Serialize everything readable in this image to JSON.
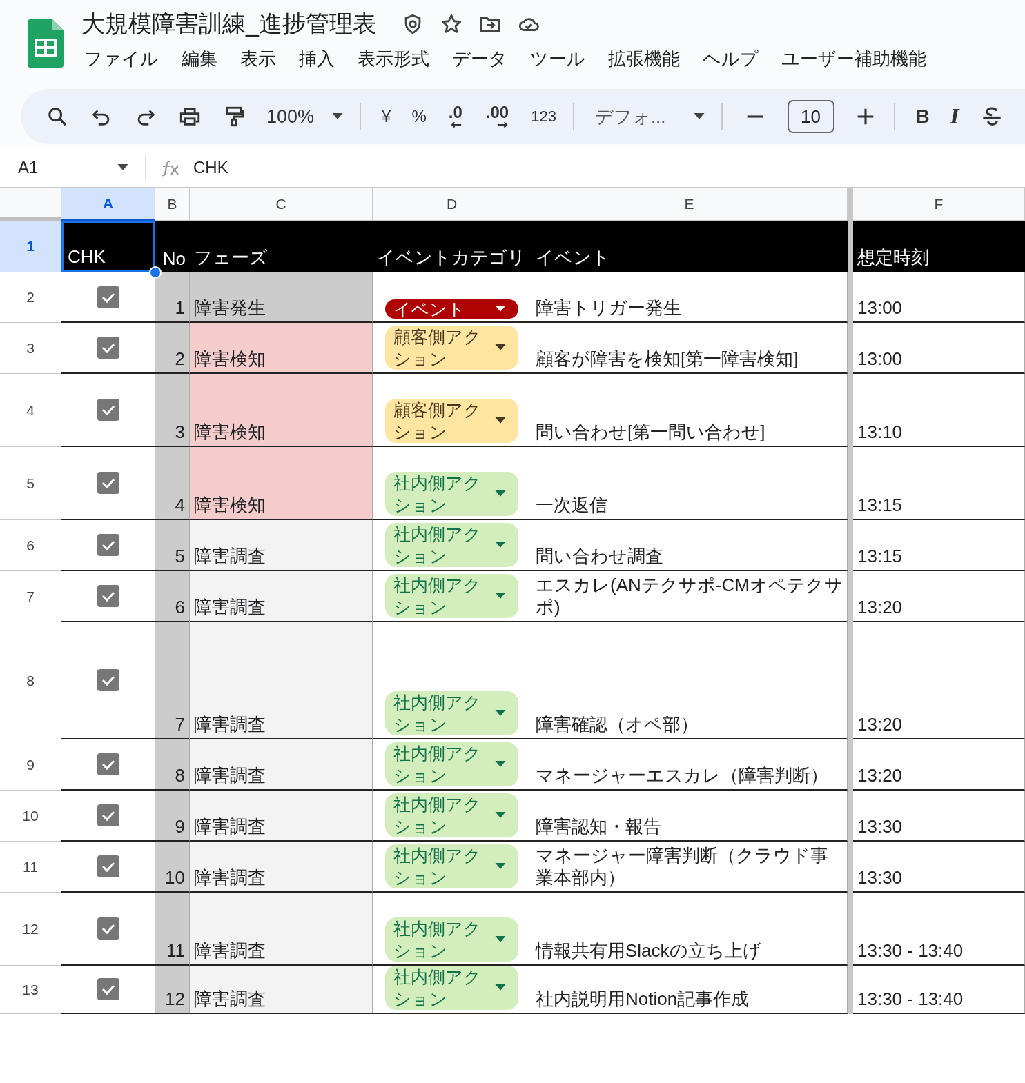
{
  "document": {
    "title": "大規模障害訓練_進捗管理表"
  },
  "menu": [
    "ファイル",
    "編集",
    "表示",
    "挿入",
    "表示形式",
    "データ",
    "ツール",
    "拡張機能",
    "ヘルプ",
    "ユーザー補助機能"
  ],
  "toolbar": {
    "zoom": "100%",
    "currency": "¥",
    "percent": "%",
    "decrease_decimal": ".0",
    "increase_decimal": ".00",
    "number_format": "123",
    "font": "デフォ...",
    "font_size": "10",
    "bold": "B",
    "italic": "I"
  },
  "formula_bar": {
    "cell_ref": "A1",
    "value": "CHK"
  },
  "columns": [
    {
      "label": "A",
      "selected": true
    },
    {
      "label": "B",
      "selected": false
    },
    {
      "label": "C",
      "selected": false
    },
    {
      "label": "D",
      "selected": false
    },
    {
      "label": "E",
      "selected": false
    },
    {
      "label": "F",
      "selected": false
    }
  ],
  "header_row": {
    "row_number": "1",
    "cells": [
      "CHK",
      "No",
      "フェーズ",
      "イベントカテゴリ",
      "イベント",
      "想定時刻"
    ]
  },
  "rows": [
    {
      "row_number": "2",
      "checked": true,
      "no": "1",
      "phase": "障害発生",
      "color": "#cccccc",
      "category": {
        "kind": "event",
        "label": "イベント"
      },
      "event": "障害トリガー発生",
      "time": "13:00"
    },
    {
      "row_number": "3",
      "checked": true,
      "no": "2",
      "phase": "障害検知",
      "color": "#f4cccc",
      "category": {
        "kind": "customer",
        "label": "顧客側アクション"
      },
      "event": "顧客が障害を検知[第一障害検知]",
      "time": "13:00"
    },
    {
      "row_number": "4",
      "checked": true,
      "no": "3",
      "phase": "障害検知",
      "color": "#f4cccc",
      "category": {
        "kind": "customer",
        "label": "顧客側アクション"
      },
      "event": "問い合わせ[第一問い合わせ]",
      "time": "13:10"
    },
    {
      "row_number": "5",
      "checked": true,
      "no": "4",
      "phase": "障害検知",
      "color": "#f4cccc",
      "category": {
        "kind": "internal",
        "label": "社内側アクション"
      },
      "event": "一次返信",
      "time": "13:15"
    },
    {
      "row_number": "6",
      "checked": true,
      "no": "5",
      "phase": "障害調査",
      "color": "#f3f3f3",
      "category": {
        "kind": "internal",
        "label": "社内側アクション"
      },
      "event": "問い合わせ調査",
      "time": "13:15"
    },
    {
      "row_number": "7",
      "checked": true,
      "no": "6",
      "phase": "障害調査",
      "color": "#f3f3f3",
      "category": {
        "kind": "internal",
        "label": "社内側アクション"
      },
      "event": "エスカレ(ANテクサポ-CMオペテクサポ)",
      "time": "13:20"
    },
    {
      "row_number": "8",
      "checked": true,
      "no": "7",
      "phase": "障害調査",
      "color": "#f3f3f3",
      "category": {
        "kind": "internal",
        "label": "社内側アクション"
      },
      "event": "障害確認（オペ部）",
      "time": "13:20"
    },
    {
      "row_number": "9",
      "checked": true,
      "no": "8",
      "phase": "障害調査",
      "color": "#f3f3f3",
      "category": {
        "kind": "internal",
        "label": "社内側アクション"
      },
      "event": "マネージャーエスカレ（障害判断）",
      "time": "13:20"
    },
    {
      "row_number": "10",
      "checked": true,
      "no": "9",
      "phase": "障害調査",
      "color": "#f3f3f3",
      "category": {
        "kind": "internal",
        "label": "社内側アクション"
      },
      "event": "障害認知・報告",
      "time": "13:30"
    },
    {
      "row_number": "11",
      "checked": true,
      "no": "10",
      "phase": "障害調査",
      "color": "#f3f3f3",
      "category": {
        "kind": "internal",
        "label": "社内側アクション"
      },
      "event": "マネージャー障害判断（クラウド事業本部内）",
      "time": "13:30"
    },
    {
      "row_number": "12",
      "checked": true,
      "no": "11",
      "phase": "障害調査",
      "color": "#f3f3f3",
      "category": {
        "kind": "internal",
        "label": "社内側アクション"
      },
      "event": "情報共有用Slackの立ち上げ",
      "time": "13:30 - 13:40"
    },
    {
      "row_number": "13",
      "checked": true,
      "no": "12",
      "phase": "障害調査",
      "color": "#f3f3f3",
      "category": {
        "kind": "internal",
        "label": "社内側アクション"
      },
      "event": "社内説明用Notion記事作成",
      "time": "13:30 - 13:40"
    }
  ]
}
